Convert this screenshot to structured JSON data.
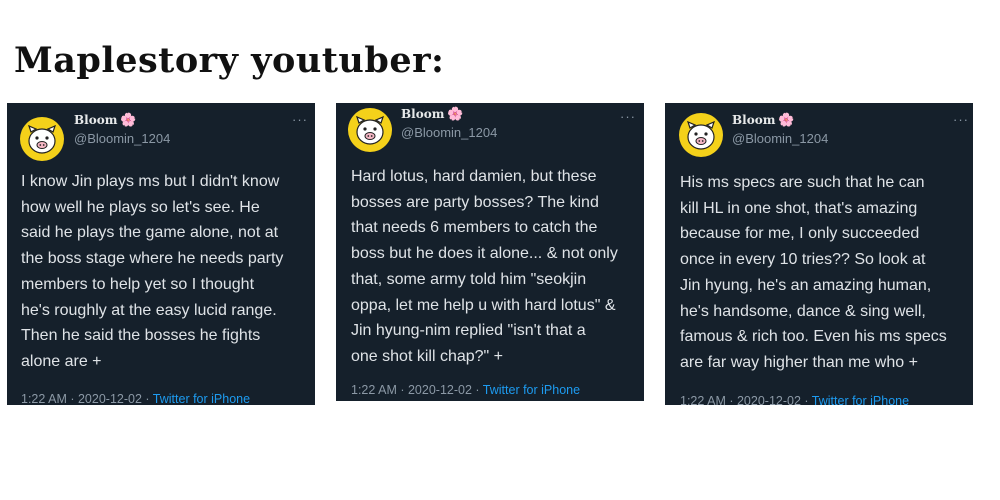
{
  "heading": "Maplestory youtuber:",
  "icons": {
    "avatar": "pig-face-avatar-icon",
    "flower": "cherry-blossom-icon",
    "more": "more-options-icon"
  },
  "colors": {
    "card_bg": "#15202b",
    "link": "#1d9bf0",
    "avatar_bg": "#f4d11a"
  },
  "tweets": [
    {
      "name": "Bloom",
      "flower": "🌸",
      "handle": "@Bloomin_1204",
      "more": "···",
      "text": "I know Jin plays ms but I didn't know\nhow well he plays so let's see. He\nsaid he plays the game alone, not at\nthe boss stage where he needs party\nmembers to help yet so I thought\nhe's roughly at the easy lucid range.\nThen he said the bosses he fights\nalone are +",
      "time": "1:22 AM · 2020-12-02 · ",
      "source": "Twitter for iPhone"
    },
    {
      "name": "Bloom",
      "flower": "🌸",
      "handle": "@Bloomin_1204",
      "more": "···",
      "text": "Hard lotus, hard damien, but these\nbosses are party bosses? The kind\nthat needs 6 members to catch the\nboss but he does it alone... & not only\nthat, some army told him \"seokjin\noppa, let me help u with hard lotus\" &\nJin hyung-nim replied \"isn't that a\none shot kill chap?\" +",
      "time": "1:22 AM · 2020-12-02 · ",
      "source": "Twitter for iPhone"
    },
    {
      "name": "Bloom",
      "flower": "🌸",
      "handle": "@Bloomin_1204",
      "more": "···",
      "text": "His ms specs are such that he can\nkill HL in one shot, that's amazing\nbecause for me, I only succeeded\nonce in every 10 tries?? So look at\nJin hyung, he's an amazing human,\nhe's handsome, dance & sing well,\nfamous & rich too. Even his ms specs\nare far way higher than me who +",
      "time": "1:22 AM · 2020-12-02 · ",
      "source": "Twitter for iPhone"
    }
  ]
}
